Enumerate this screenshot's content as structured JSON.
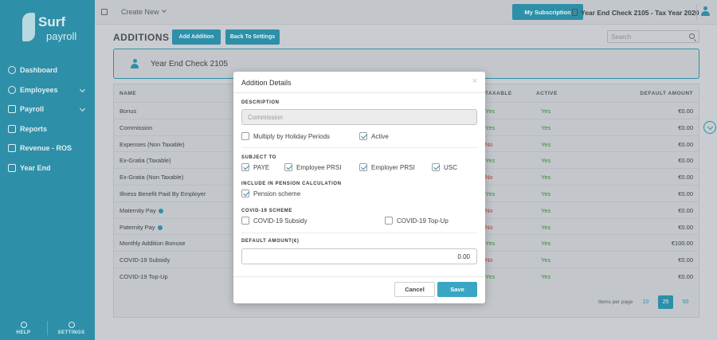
{
  "app": {
    "logo_line1": "Surf",
    "logo_line2": "payroll"
  },
  "sidebar": {
    "items": [
      {
        "label": "Dashboard",
        "icon": "dashboard-icon"
      },
      {
        "label": "Employees",
        "icon": "user-icon",
        "has_caret": true
      },
      {
        "label": "Payroll",
        "icon": "payroll-icon",
        "has_caret": true
      },
      {
        "label": "Reports",
        "icon": "reports-icon"
      },
      {
        "label": "Revenue - ROS",
        "icon": "chart-icon"
      },
      {
        "label": "Year End",
        "icon": "calendar-icon"
      }
    ],
    "help_label": "HELP",
    "settings_label": "SETTINGS"
  },
  "topbar": {
    "create_new": "Create New",
    "subscription_button": "My Subscription",
    "year_label": "Year End Check 2105 - Tax Year 2020"
  },
  "page": {
    "title": "ADDITIONS",
    "add_button": "Add Addition",
    "back_button": "Back To Settings",
    "search_placeholder": "Search",
    "card_title": "Year End Check 2105"
  },
  "table": {
    "headers": {
      "name": "NAME",
      "taxable": "TAXABLE",
      "active": "ACTIVE",
      "default_amount": "DEFAULT AMOUNT"
    },
    "rows": [
      {
        "name": "Bonus",
        "taxable": "Yes",
        "active": "Yes",
        "amount": "€0.00",
        "info": false
      },
      {
        "name": "Commission",
        "taxable": "Yes",
        "active": "Yes",
        "amount": "€0.00",
        "info": false
      },
      {
        "name": "Expenses (Non Taxable)",
        "taxable": "No",
        "active": "Yes",
        "amount": "€0.00",
        "info": false
      },
      {
        "name": "Ex-Gratia (Taxable)",
        "taxable": "Yes",
        "active": "Yes",
        "amount": "€0.00",
        "info": false
      },
      {
        "name": "Ex-Gratia (Non Taxable)",
        "taxable": "No",
        "active": "Yes",
        "amount": "€0.00",
        "info": false
      },
      {
        "name": "Illness Benefit Paid By Employer",
        "taxable": "Yes",
        "active": "Yes",
        "amount": "€0.00",
        "info": false
      },
      {
        "name": "Maternity Pay",
        "taxable": "No",
        "active": "Yes",
        "amount": "€0.00",
        "info": true
      },
      {
        "name": "Paternity Pay",
        "taxable": "No",
        "active": "Yes",
        "amount": "€0.00",
        "info": true
      },
      {
        "name": "Monthly Addition Bonuse",
        "taxable": "Yes",
        "active": "Yes",
        "amount": "€100.00",
        "info": false
      },
      {
        "name": "COVID-19 Subsidy",
        "taxable": "No",
        "active": "Yes",
        "amount": "€0.00",
        "info": false
      },
      {
        "name": "COVID-19 Top-Up",
        "taxable": "Yes",
        "active": "Yes",
        "amount": "€0.00",
        "info": false
      }
    ],
    "pager": {
      "label": "Items per page",
      "options": [
        "10",
        "25",
        "50"
      ],
      "selected": "25"
    }
  },
  "modal": {
    "title": "Addition Details",
    "close_glyph": "×",
    "description_label": "DESCRIPTION",
    "description_value": "Commission",
    "multiply_label": "Multiply by Holiday Periods",
    "multiply_checked": false,
    "active_label": "Active",
    "active_checked": true,
    "subject_to_label": "SUBJECT TO",
    "paye_label": "PAYE",
    "employee_prsi_label": "Employee PRSI",
    "employer_prsi_label": "Employer PRSI",
    "usc_label": "USC",
    "pension_section_label": "INCLUDE IN PENSION CALCULATION",
    "pension_scheme_label": "Pension scheme",
    "covid_section_label": "COVID-19 SCHEME",
    "covid_subsidy_label": "COVID-19 Subsidy",
    "covid_topup_label": "COVID-19 Top-Up",
    "default_amount_label": "DEFAULT AMOUNT(€)",
    "default_amount_value": "0.00",
    "cancel_label": "Cancel",
    "save_label": "Save"
  },
  "colors": {
    "brand": "#2e8fa8",
    "save": "#3aa6c4",
    "yes": "#3b8a3f",
    "no": "#b0403c"
  }
}
